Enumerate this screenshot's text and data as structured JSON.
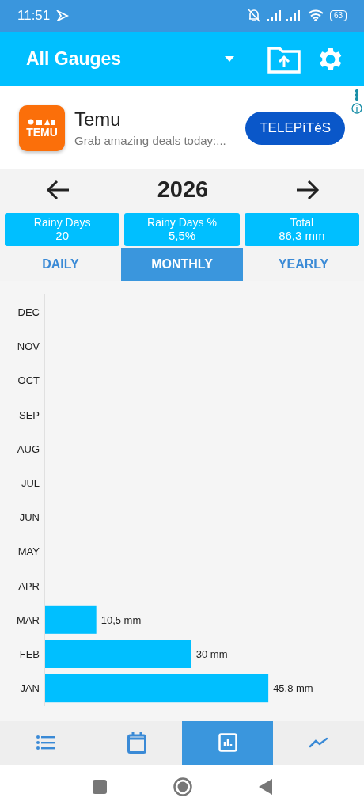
{
  "status_bar": {
    "time": "11:51",
    "battery": "63"
  },
  "app_bar": {
    "title": "All Gauges"
  },
  "ad": {
    "logo_text": "TEMU",
    "title": "Temu",
    "subtitle": "Grab amazing deals today:...",
    "button": "TELEPíTéS"
  },
  "year_nav": {
    "year": "2026"
  },
  "stats": [
    {
      "label": "Rainy Days",
      "value": "20"
    },
    {
      "label": "Rainy Days %",
      "value": "5,5%"
    },
    {
      "label": "Total",
      "value": "86,3 mm"
    }
  ],
  "mode_tabs": [
    {
      "label": "DAILY",
      "selected": false
    },
    {
      "label": "MONTHLY",
      "selected": true
    },
    {
      "label": "YEARLY",
      "selected": false
    }
  ],
  "chart_data": {
    "type": "bar",
    "orientation": "horizontal",
    "categories": [
      "DEC",
      "NOV",
      "OCT",
      "SEP",
      "AUG",
      "JUL",
      "JUN",
      "MAY",
      "APR",
      "MAR",
      "FEB",
      "JAN"
    ],
    "values": [
      null,
      null,
      null,
      null,
      null,
      null,
      null,
      null,
      null,
      10.5,
      30,
      45.8
    ],
    "value_labels": [
      null,
      null,
      null,
      null,
      null,
      null,
      null,
      null,
      null,
      "10,5 mm",
      "30 mm",
      "45,8 mm"
    ]
  },
  "bottom_nav": [
    {
      "kind": "list",
      "selected": false
    },
    {
      "kind": "calendar",
      "selected": false
    },
    {
      "kind": "chart",
      "selected": true
    },
    {
      "kind": "trend",
      "selected": false
    }
  ]
}
